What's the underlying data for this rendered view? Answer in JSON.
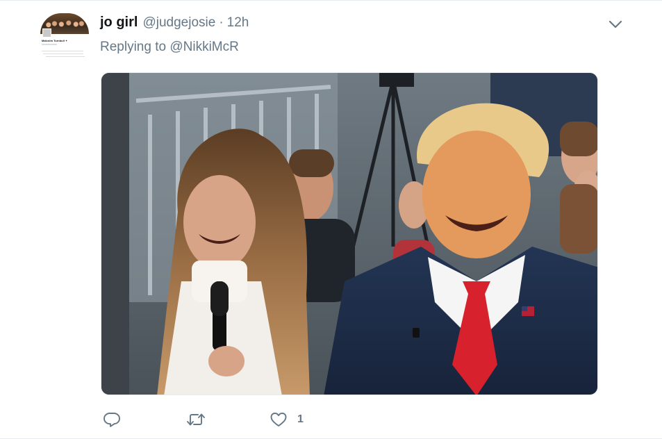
{
  "tweet": {
    "display_name": "jo girl",
    "handle": "@judgejosie",
    "separator": "·",
    "time": "12h",
    "replying_prefix": "Replying to",
    "replying_to": "@NikkiMcR",
    "like_count": "1"
  },
  "avatar": {
    "mini_name": "Malcolm Turnbull ✦"
  },
  "icons": {
    "caret": "chevron-down-icon",
    "reply": "reply-icon",
    "retweet": "retweet-icon",
    "like": "heart-icon"
  },
  "colors": {
    "text_primary": "#14171a",
    "text_secondary": "#657786",
    "icon": "#657786",
    "border": "#e6ecf0"
  }
}
